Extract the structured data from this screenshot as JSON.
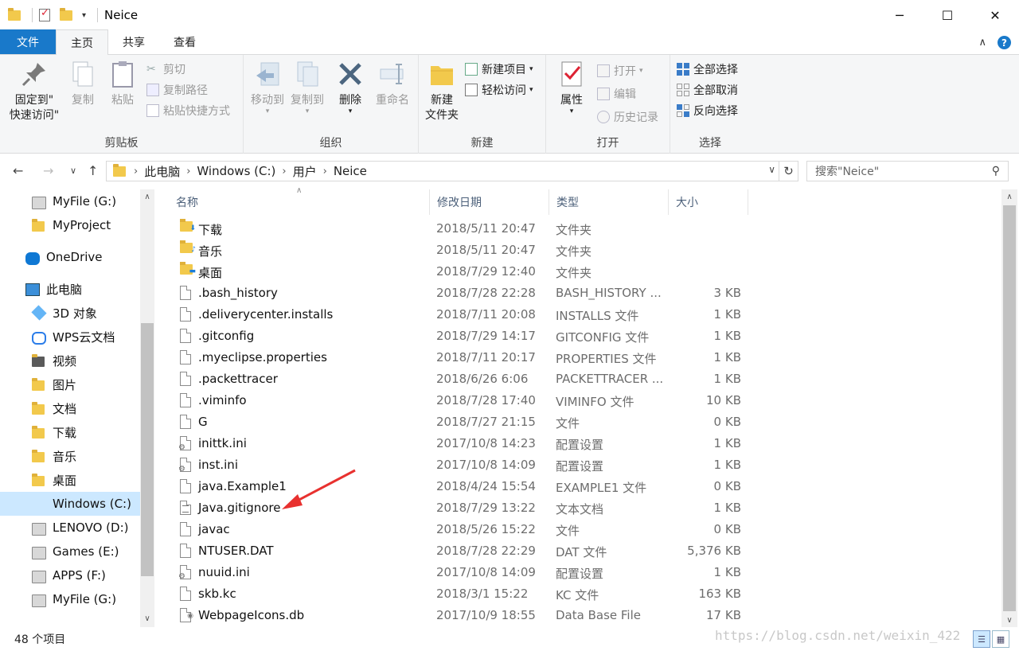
{
  "window": {
    "title": "Neice"
  },
  "ribbon_tabs": [
    {
      "label": "文件"
    },
    {
      "label": "主页"
    },
    {
      "label": "共享"
    },
    {
      "label": "查看"
    }
  ],
  "clipboard": {
    "pin_line1": "固定到\"",
    "pin_line2": "快速访问\"",
    "copy": "复制",
    "paste": "粘贴",
    "cut": "剪切",
    "copy_path": "复制路径",
    "paste_shortcut": "粘贴快捷方式",
    "label": "剪贴板"
  },
  "organize": {
    "move_to": "移动到",
    "copy_to": "复制到",
    "delete": "删除",
    "rename": "重命名",
    "label": "组织"
  },
  "new": {
    "new_folder_line1": "新建",
    "new_folder_line2": "文件夹",
    "new_item": "新建项目",
    "easy_access": "轻松访问",
    "label": "新建"
  },
  "open": {
    "properties": "属性",
    "open": "打开",
    "edit": "编辑",
    "history": "历史记录",
    "label": "打开"
  },
  "select": {
    "select_all": "全部选择",
    "select_none": "全部取消",
    "invert": "反向选择",
    "label": "选择"
  },
  "address": {
    "crumbs": [
      "此电脑",
      "Windows (C:)",
      "用户",
      "Neice"
    ]
  },
  "search": {
    "placeholder": "搜索\"Neice\""
  },
  "nav_items": [
    {
      "label": "MyFile (G:)"
    },
    {
      "label": "MyProject"
    },
    {
      "label": "OneDrive"
    },
    {
      "label": "此电脑"
    },
    {
      "label": "3D 对象"
    },
    {
      "label": "WPS云文档"
    },
    {
      "label": "视频"
    },
    {
      "label": "图片"
    },
    {
      "label": "文档"
    },
    {
      "label": "下载"
    },
    {
      "label": "音乐"
    },
    {
      "label": "桌面"
    },
    {
      "label": "Windows (C:)"
    },
    {
      "label": "LENOVO (D:)"
    },
    {
      "label": "Games (E:)"
    },
    {
      "label": "APPS (F:)"
    },
    {
      "label": "MyFile (G:)"
    }
  ],
  "columns": {
    "name": "名称",
    "date": "修改日期",
    "type": "类型",
    "size": "大小"
  },
  "files": [
    {
      "name": "下载",
      "date": "2018/5/11 20:47",
      "type": "文件夹",
      "size": "",
      "icon": "folder-download-icon"
    },
    {
      "name": "音乐",
      "date": "2018/5/11 20:47",
      "type": "文件夹",
      "size": "",
      "icon": "folder-music-icon"
    },
    {
      "name": "桌面",
      "date": "2018/7/29 12:40",
      "type": "文件夹",
      "size": "",
      "icon": "folder-desktop-icon"
    },
    {
      "name": ".bash_history",
      "date": "2018/7/28 22:28",
      "type": "BASH_HISTORY ...",
      "size": "3 KB",
      "icon": "file-icon"
    },
    {
      "name": ".deliverycenter.installs",
      "date": "2018/7/11 20:08",
      "type": "INSTALLS 文件",
      "size": "1 KB",
      "icon": "file-icon"
    },
    {
      "name": ".gitconfig",
      "date": "2018/7/29 14:17",
      "type": "GITCONFIG 文件",
      "size": "1 KB",
      "icon": "file-icon"
    },
    {
      "name": ".myeclipse.properties",
      "date": "2018/7/11 20:17",
      "type": "PROPERTIES 文件",
      "size": "1 KB",
      "icon": "file-icon"
    },
    {
      "name": ".packettracer",
      "date": "2018/6/26 6:06",
      "type": "PACKETTRACER ...",
      "size": "1 KB",
      "icon": "file-icon"
    },
    {
      "name": ".viminfo",
      "date": "2018/7/28 17:40",
      "type": "VIMINFO 文件",
      "size": "10 KB",
      "icon": "file-icon"
    },
    {
      "name": "G",
      "date": "2018/7/27 21:15",
      "type": "文件",
      "size": "0 KB",
      "icon": "file-icon"
    },
    {
      "name": "inittk.ini",
      "date": "2017/10/8 14:23",
      "type": "配置设置",
      "size": "1 KB",
      "icon": "ini-file-icon"
    },
    {
      "name": "inst.ini",
      "date": "2017/10/8 14:09",
      "type": "配置设置",
      "size": "1 KB",
      "icon": "ini-file-icon"
    },
    {
      "name": "java.Example1",
      "date": "2018/4/24 15:54",
      "type": "EXAMPLE1 文件",
      "size": "0 KB",
      "icon": "file-icon"
    },
    {
      "name": "Java.gitignore",
      "date": "2018/7/29 13:22",
      "type": "文本文档",
      "size": "1 KB",
      "icon": "text-file-icon"
    },
    {
      "name": "javac",
      "date": "2018/5/26 15:22",
      "type": "文件",
      "size": "0 KB",
      "icon": "file-icon"
    },
    {
      "name": "NTUSER.DAT",
      "date": "2018/7/28 22:29",
      "type": "DAT 文件",
      "size": "5,376 KB",
      "icon": "file-icon"
    },
    {
      "name": "nuuid.ini",
      "date": "2017/10/8 14:09",
      "type": "配置设置",
      "size": "1 KB",
      "icon": "ini-file-icon"
    },
    {
      "name": "skb.kc",
      "date": "2018/3/1 15:22",
      "type": "KC 文件",
      "size": "163 KB",
      "icon": "file-icon"
    },
    {
      "name": "WebpageIcons.db",
      "date": "2017/10/9 18:55",
      "type": "Data Base File",
      "size": "17 KB",
      "icon": "db-file-icon"
    }
  ],
  "status": {
    "count": "48 个项目"
  },
  "watermark": "https://blog.csdn.net/weixin_422",
  "colors": {
    "accent": "#1979ca",
    "selection": "#cce8ff",
    "annotation_arrow": "#e8312f"
  }
}
